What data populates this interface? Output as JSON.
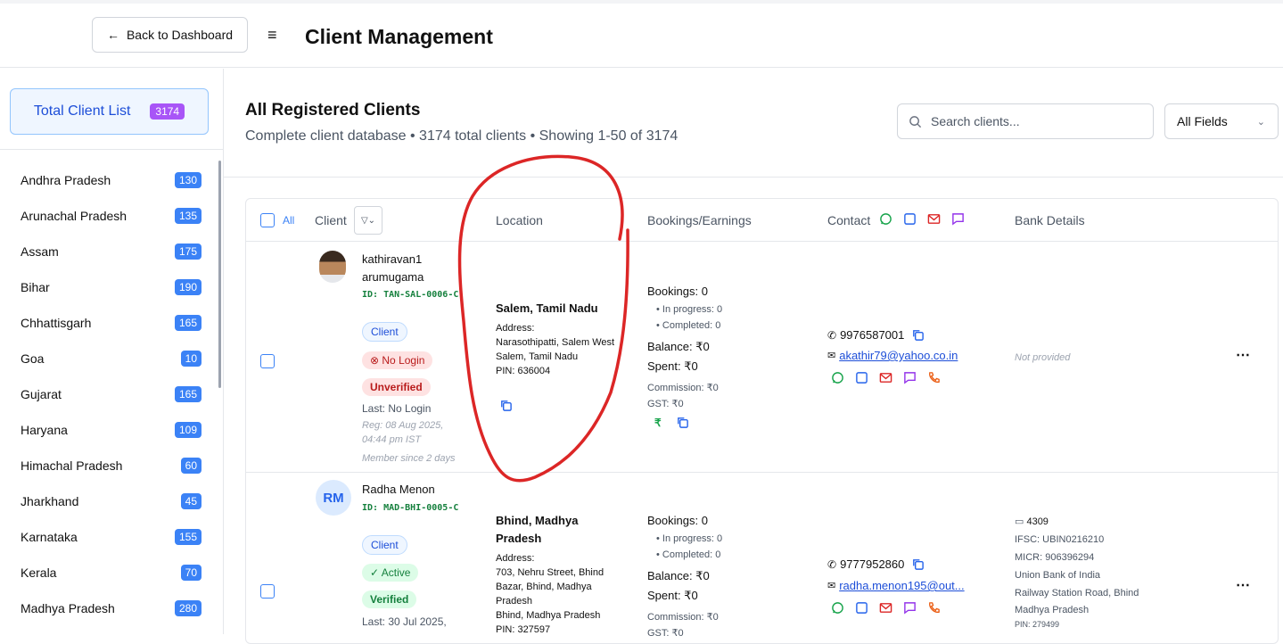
{
  "header": {
    "back_label": "Back to Dashboard",
    "title": "Client Management"
  },
  "sidebar": {
    "total_label": "Total Client List",
    "total_count": "3174",
    "states": [
      {
        "name": "Andhra Pradesh",
        "count": "130"
      },
      {
        "name": "Arunachal Pradesh",
        "count": "135"
      },
      {
        "name": "Assam",
        "count": "175"
      },
      {
        "name": "Bihar",
        "count": "190"
      },
      {
        "name": "Chhattisgarh",
        "count": "165"
      },
      {
        "name": "Goa",
        "count": "10"
      },
      {
        "name": "Gujarat",
        "count": "165"
      },
      {
        "name": "Haryana",
        "count": "109"
      },
      {
        "name": "Himachal Pradesh",
        "count": "60"
      },
      {
        "name": "Jharkhand",
        "count": "45"
      },
      {
        "name": "Karnataka",
        "count": "155"
      },
      {
        "name": "Kerala",
        "count": "70"
      },
      {
        "name": "Madhya Pradesh",
        "count": "280"
      }
    ]
  },
  "main": {
    "title": "All Registered Clients",
    "subtitle": "Complete client database • 3174 total clients • Showing 1-50 of 3174",
    "search_placeholder": "Search clients...",
    "field_select": "All Fields"
  },
  "table": {
    "headers": {
      "all": "All",
      "client": "Client",
      "location": "Location",
      "bookings": "Bookings/Earnings",
      "contact": "Contact",
      "bank": "Bank Details"
    },
    "rows": [
      {
        "name_line1": "kathiravan1",
        "name_line2": "arumugama",
        "id": "ID: TAN-SAL-0006-C",
        "role": "Client",
        "login_status": "No Login",
        "verify_status": "Unverified",
        "last": "Last: No Login",
        "reg": "Reg: 08 Aug 2025, 04:44 pm IST",
        "member": "Member since 2 days",
        "location_title": "Salem, Tamil Nadu",
        "address_label": "Address:",
        "address": "Narasothipatti, Salem West",
        "city": "Salem, Tamil Nadu",
        "pin": "PIN: 636004",
        "bookings": "Bookings: 0",
        "in_progress": "• In progress: 0",
        "completed": "• Completed: 0",
        "balance": "Balance: ₹0",
        "spent": "Spent: ₹0",
        "commission": "Commission: ₹0",
        "gst": "GST: ₹0",
        "phone": "9976587001",
        "email": "akathir79@yahoo.co.in",
        "bank_missing": "Not provided"
      },
      {
        "initials": "RM",
        "name_line1": "Radha Menon",
        "id": "ID: MAD-BHI-0005-C",
        "role": "Client",
        "login_status": "Active",
        "verify_status": "Verified",
        "last": "Last: 30 Jul 2025,",
        "location_title": "Bhind, Madhya Pradesh",
        "address_label": "Address:",
        "address": "703, Nehru Street, Bhind Bazar, Bhind, Madhya Pradesh",
        "city": "Bhind, Madhya Pradesh",
        "pin": "PIN: 327597",
        "bookings": "Bookings: 0",
        "in_progress": "• In progress: 0",
        "completed": "• Completed: 0",
        "balance": "Balance: ₹0",
        "spent": "Spent: ₹0",
        "commission": "Commission: ₹0",
        "gst": "GST: ₹0",
        "phone": "9777952860",
        "email": "radha.menon195@out...",
        "bank_acct": "4309",
        "ifsc": "IFSC: UBIN0216210",
        "micr": "MICR: 906396294",
        "bank_name": "Union Bank of India",
        "branch": "Railway Station Road, Bhind",
        "bank_state": "Madhya Pradesh",
        "bank_pin": "PIN: 279499"
      }
    ]
  },
  "colors": {
    "accent": "#3b82f6",
    "total_badge": "#a855f7",
    "annotation": "#dc2626"
  }
}
